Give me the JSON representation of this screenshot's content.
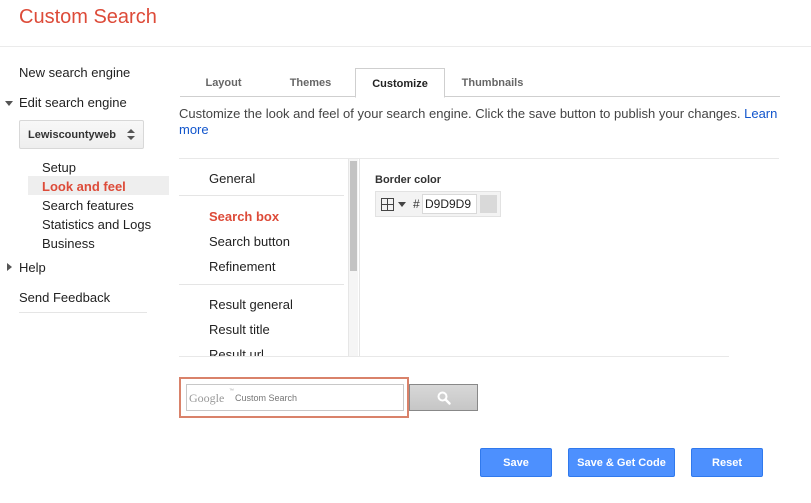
{
  "app": {
    "title": "Custom Search"
  },
  "sidebar": {
    "new_engine": "New search engine",
    "edit_engine": "Edit search engine",
    "engine_selected": "Lewiscountyweb",
    "sub_items": [
      "Setup",
      "Look and feel",
      "Search features",
      "Statistics and Logs",
      "Business"
    ],
    "help": "Help",
    "feedback": "Send Feedback"
  },
  "tabs": [
    {
      "label": "Layout"
    },
    {
      "label": "Themes"
    },
    {
      "label": "Customize"
    },
    {
      "label": "Thumbnails"
    }
  ],
  "description": {
    "text": "Customize the look and feel of your search engine. Click the save button to publish your changes. ",
    "link": "Learn more"
  },
  "sections": [
    "General",
    "Search box",
    "Search button",
    "Refinement",
    "Result general",
    "Result title",
    "Result url"
  ],
  "property": {
    "label": "Border color",
    "hash": "#",
    "value": "D9D9D9",
    "swatch_color": "#d9d9d9"
  },
  "preview": {
    "logo": "Google",
    "tm": "™",
    "placeholder": "Custom Search"
  },
  "actions": {
    "save": "Save",
    "save_get_code": "Save & Get Code",
    "reset": "Reset"
  },
  "colors": {
    "accent_red": "#dd4b39",
    "button_blue": "#4d90fe",
    "link_blue": "#1155cc"
  }
}
